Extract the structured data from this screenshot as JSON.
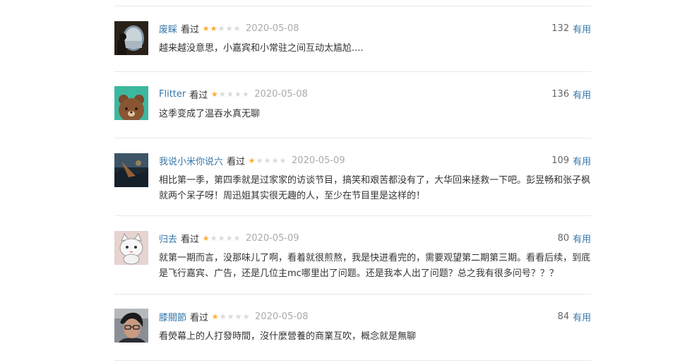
{
  "reviews": [
    {
      "user": "废睬",
      "status": "看过",
      "rating": 2,
      "date": "2020-05-08",
      "vote_count": "132",
      "vote_label": "有用",
      "content": "越来越没意思，小嘉宾和小常驻之间互动太尴尬....",
      "avatar": "airplane-window-photo"
    },
    {
      "user": "Flitter",
      "status": "看过",
      "rating": 1,
      "date": "2020-05-08",
      "vote_count": "136",
      "vote_label": "有用",
      "content": "这季变成了温吞水真无聊",
      "avatar": "brown-bear-cartoon"
    },
    {
      "user": "我说小米你说六",
      "status": "看过",
      "rating": 1,
      "date": "2020-05-09",
      "vote_count": "109",
      "vote_label": "有用",
      "content": "相比第一季，第四季就是过家家的访谈节目，搞笑和艰苦都没有了，大华回来拯救一下吧。彭昱畅和张子枫就两个呆子呀！周迅姐其实很无趣的人，至少在节目里是这样的！",
      "avatar": "dark-landscape-photo"
    },
    {
      "user": "归去",
      "status": "看过",
      "rating": 1,
      "date": "2020-05-09",
      "vote_count": "80",
      "vote_label": "有用",
      "content": "就第一期而言，没那味儿了啊，看着就很煎熬，我是快进看完的，需要观望第二期第三期。看看后续，到底是飞行嘉宾、广告，还是几位主mc哪里出了问题。还是我本人出了问题？总之我有很多问号？？？",
      "avatar": "cartoon-cat"
    },
    {
      "user": "膝關節",
      "status": "看过",
      "rating": 1,
      "date": "2020-05-08",
      "vote_count": "84",
      "vote_label": "有用",
      "content": "看熒幕上的人打發時間，沒什麼營養的商業互吹，概念就是無聊",
      "avatar": "person-with-glasses-photo"
    }
  ]
}
